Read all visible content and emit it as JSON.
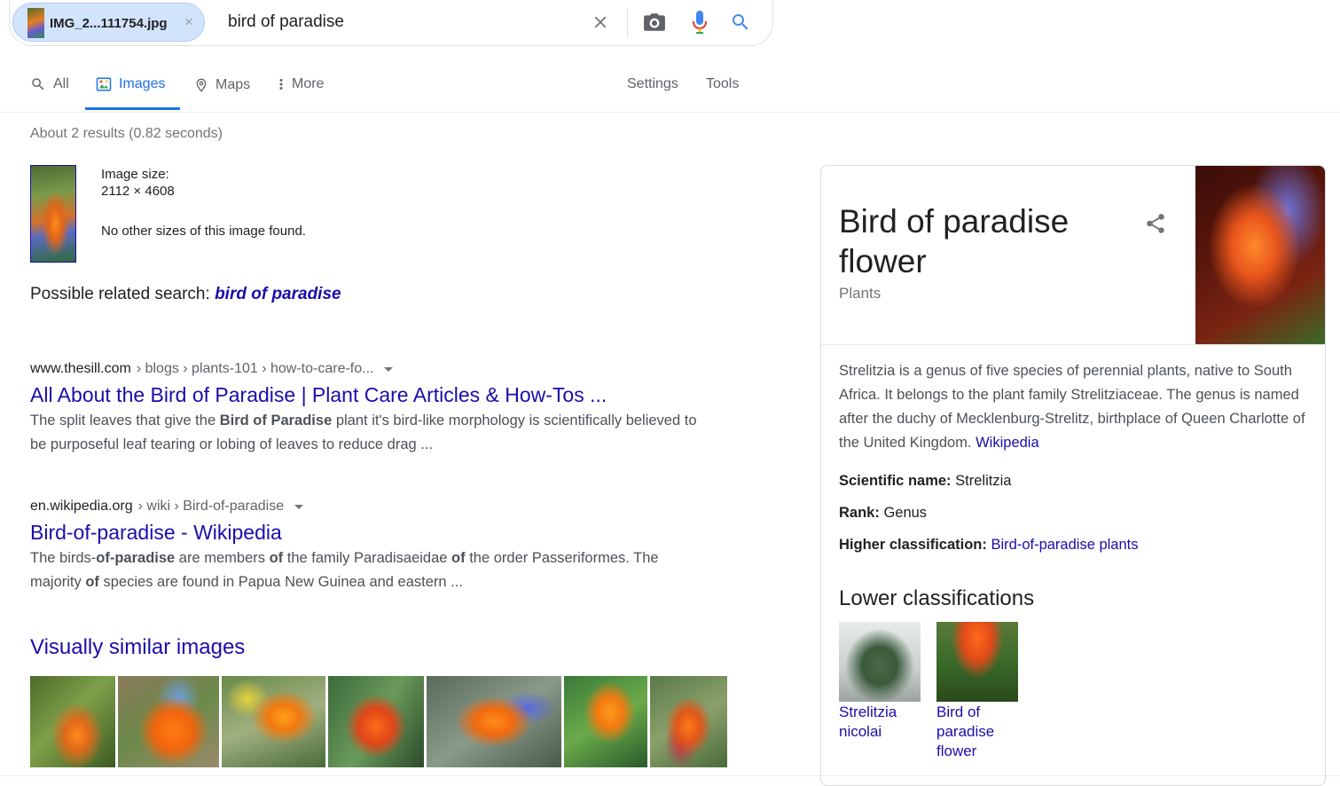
{
  "search": {
    "chip_label": "IMG_2...111754.jpg",
    "chip_close": "×",
    "query": "bird of paradise"
  },
  "tabs": [
    {
      "label": "All",
      "icon": "search-icon"
    },
    {
      "label": "Images",
      "icon": "image-icon",
      "active": true
    },
    {
      "label": "Maps",
      "icon": "map-pin-icon"
    },
    {
      "label": "More",
      "icon": "more-vert-icon"
    }
  ],
  "tools": {
    "settings": "Settings",
    "tools": "Tools"
  },
  "stats": "About 2 results (0.82 seconds)",
  "image_info": {
    "size_label": "Image size:",
    "size_value": "2112 × 4608",
    "no_sizes": "No other sizes of this image found."
  },
  "related": {
    "prefix": "Possible related search:",
    "link": "bird of paradise"
  },
  "results": [
    {
      "domain": "www.thesill.com",
      "breadcrumb": "› blogs › plants-101 › how-to-care-fo...",
      "title": "All About the Bird of Paradise | Plant Care Articles & How-Tos ...",
      "snippet_parts": [
        {
          "t": "The split leaves that give the ",
          "b": false
        },
        {
          "t": "Bird of Paradise",
          "b": true
        },
        {
          "t": " plant it's bird-like morphology is scientifically believed to be purposeful leaf tearing or lobing of leaves to reduce drag ...",
          "b": false
        }
      ]
    },
    {
      "domain": "en.wikipedia.org",
      "breadcrumb": "› wiki › Bird-of-paradise",
      "title": "Bird-of-paradise - Wikipedia",
      "snippet_parts": [
        {
          "t": "The birds-",
          "b": false
        },
        {
          "t": "of-paradise",
          "b": true
        },
        {
          "t": " are members ",
          "b": false
        },
        {
          "t": "of",
          "b": true
        },
        {
          "t": " the family Paradisaeidae ",
          "b": false
        },
        {
          "t": "of",
          "b": true
        },
        {
          "t": " the order Passeriformes. The majority ",
          "b": false
        },
        {
          "t": "of",
          "b": true
        },
        {
          "t": " species are found in Papua New Guinea and eastern ...",
          "b": false
        }
      ]
    }
  ],
  "visually_similar": {
    "title": "Visually similar images",
    "count": 7
  },
  "knowledge_panel": {
    "title": "Bird of paradise flower",
    "subtitle": "Plants",
    "description": "Strelitzia is a genus of five species of perennial plants, native to South Africa. It belongs to the plant family Strelitziaceae. The genus is named after the duchy of Mecklenburg-Strelitz, birthplace of Queen Charlotte of the United Kingdom.",
    "description_link": "Wikipedia",
    "facts": [
      {
        "label": "Scientific name:",
        "value": "Strelitzia",
        "link": false
      },
      {
        "label": "Rank:",
        "value": "Genus",
        "link": false
      },
      {
        "label": "Higher classification:",
        "value": "Bird-of-paradise plants",
        "link": true
      }
    ],
    "lower_title": "Lower classifications",
    "lower_items": [
      {
        "label": "Strelitzia nicolai"
      },
      {
        "label": "Bird of paradise flower"
      }
    ]
  },
  "colors": {
    "link": "#1a0dab",
    "accent": "#1a73e8",
    "chip_bg": "#d2e3fc",
    "mic_blue": "#4285f4",
    "mic_red": "#ea4335",
    "mic_yellow": "#fbbc04",
    "mic_green": "#34a853"
  }
}
